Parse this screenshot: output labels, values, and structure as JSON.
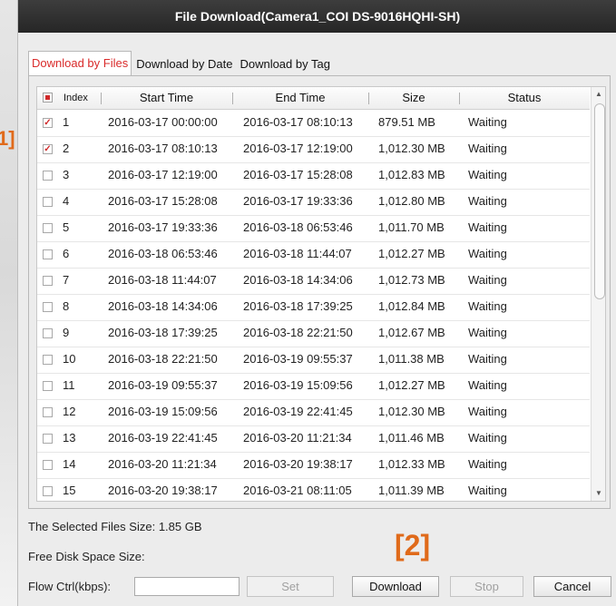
{
  "window": {
    "title": "File Download(Camera1_COI DS-9016HQHI-SH)"
  },
  "annotations": {
    "left_marker": "1]",
    "download_marker": "[2]"
  },
  "tabs": [
    {
      "label": "Download by Files",
      "active": true
    },
    {
      "label": "Download by Date",
      "active": false
    },
    {
      "label": "Download by Tag",
      "active": false
    }
  ],
  "table": {
    "headers": {
      "index": "Index",
      "start": "Start Time",
      "end": "End Time",
      "size": "Size",
      "status": "Status"
    },
    "rows": [
      {
        "index": "1",
        "start": "2016-03-17 00:00:00",
        "end": "2016-03-17 08:10:13",
        "size": "879.51 MB",
        "status": "Waiting",
        "checked": true
      },
      {
        "index": "2",
        "start": "2016-03-17 08:10:13",
        "end": "2016-03-17 12:19:00",
        "size": "1,012.30 MB",
        "status": "Waiting",
        "checked": true
      },
      {
        "index": "3",
        "start": "2016-03-17 12:19:00",
        "end": "2016-03-17 15:28:08",
        "size": "1,012.83 MB",
        "status": "Waiting",
        "checked": false
      },
      {
        "index": "4",
        "start": "2016-03-17 15:28:08",
        "end": "2016-03-17 19:33:36",
        "size": "1,012.80 MB",
        "status": "Waiting",
        "checked": false
      },
      {
        "index": "5",
        "start": "2016-03-17 19:33:36",
        "end": "2016-03-18 06:53:46",
        "size": "1,011.70 MB",
        "status": "Waiting",
        "checked": false
      },
      {
        "index": "6",
        "start": "2016-03-18 06:53:46",
        "end": "2016-03-18 11:44:07",
        "size": "1,012.27 MB",
        "status": "Waiting",
        "checked": false
      },
      {
        "index": "7",
        "start": "2016-03-18 11:44:07",
        "end": "2016-03-18 14:34:06",
        "size": "1,012.73 MB",
        "status": "Waiting",
        "checked": false
      },
      {
        "index": "8",
        "start": "2016-03-18 14:34:06",
        "end": "2016-03-18 17:39:25",
        "size": "1,012.84 MB",
        "status": "Waiting",
        "checked": false
      },
      {
        "index": "9",
        "start": "2016-03-18 17:39:25",
        "end": "2016-03-18 22:21:50",
        "size": "1,012.67 MB",
        "status": "Waiting",
        "checked": false
      },
      {
        "index": "10",
        "start": "2016-03-18 22:21:50",
        "end": "2016-03-19 09:55:37",
        "size": "1,011.38 MB",
        "status": "Waiting",
        "checked": false
      },
      {
        "index": "11",
        "start": "2016-03-19 09:55:37",
        "end": "2016-03-19 15:09:56",
        "size": "1,012.27 MB",
        "status": "Waiting",
        "checked": false
      },
      {
        "index": "12",
        "start": "2016-03-19 15:09:56",
        "end": "2016-03-19 22:41:45",
        "size": "1,012.30 MB",
        "status": "Waiting",
        "checked": false
      },
      {
        "index": "13",
        "start": "2016-03-19 22:41:45",
        "end": "2016-03-20 11:21:34",
        "size": "1,011.46 MB",
        "status": "Waiting",
        "checked": false
      },
      {
        "index": "14",
        "start": "2016-03-20 11:21:34",
        "end": "2016-03-20 19:38:17",
        "size": "1,012.33 MB",
        "status": "Waiting",
        "checked": false
      },
      {
        "index": "15",
        "start": "2016-03-20 19:38:17",
        "end": "2016-03-21 08:11:05",
        "size": "1,011.39 MB",
        "status": "Waiting",
        "checked": false
      }
    ]
  },
  "footer": {
    "selected_size_label": "The Selected Files Size:",
    "selected_size_value": "1.85 GB",
    "free_disk_label": "Free Disk Space Size:",
    "flow_label": "Flow Ctrl(kbps):",
    "flow_value": "",
    "set_label": "Set",
    "download_label": "Download",
    "stop_label": "Stop",
    "cancel_label": "Cancel"
  },
  "colors": {
    "accent": "#d92b2b",
    "marker": "#e06a1a",
    "titlebar": "#2e2e2e"
  }
}
